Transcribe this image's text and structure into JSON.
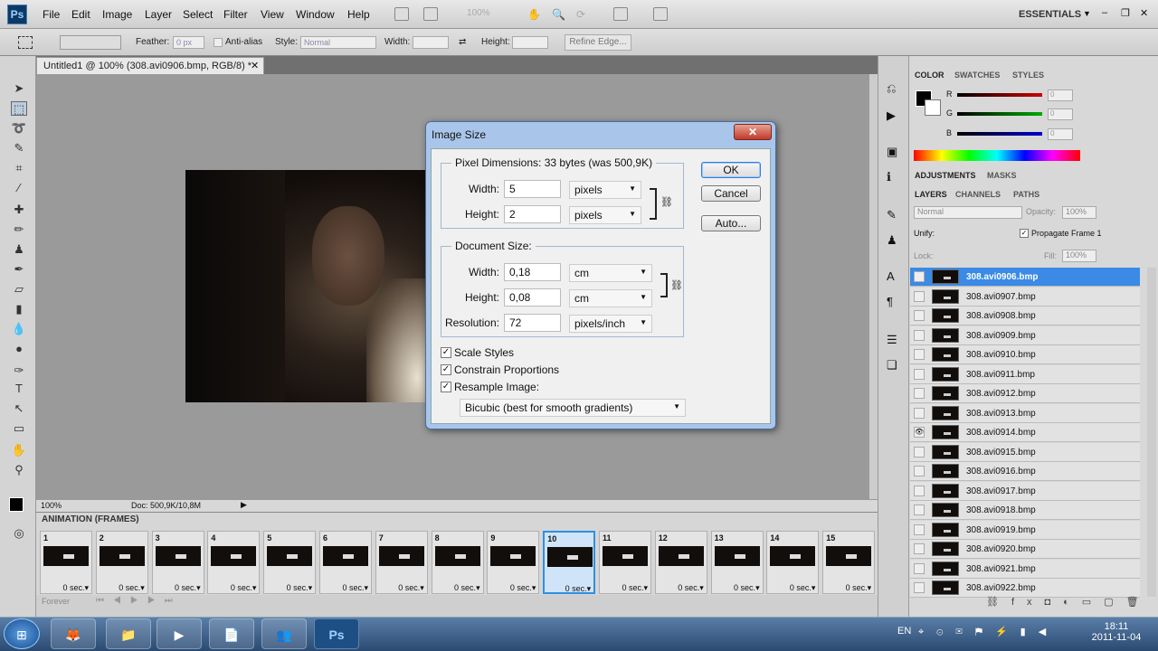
{
  "app": {
    "logo": "Ps",
    "workspace": "ESSENTIALS",
    "zoom_field": "100%"
  },
  "menu": [
    "File",
    "Edit",
    "Image",
    "Layer",
    "Select",
    "Filter",
    "View",
    "Window",
    "Help"
  ],
  "options": {
    "feather_label": "Feather:",
    "feather_value": "0 px",
    "antialias": "Anti-alias",
    "style_label": "Style:",
    "style_value": "Normal",
    "width_label": "Width:",
    "height_label": "Height:",
    "refine_edge": "Refine Edge..."
  },
  "document": {
    "tab_title": "Untitled1 @ 100% (308.avi0906.bmp, RGB/8) *",
    "status_zoom": "100%",
    "status_doc": "Doc: 500,9K/10,8M"
  },
  "animation": {
    "title": "ANIMATION (FRAMES)",
    "loop": "Forever",
    "frames": [
      {
        "n": "1",
        "d": "0 sec."
      },
      {
        "n": "2",
        "d": "0 sec."
      },
      {
        "n": "3",
        "d": "0 sec."
      },
      {
        "n": "4",
        "d": "0 sec."
      },
      {
        "n": "5",
        "d": "0 sec."
      },
      {
        "n": "6",
        "d": "0 sec."
      },
      {
        "n": "7",
        "d": "0 sec."
      },
      {
        "n": "8",
        "d": "0 sec."
      },
      {
        "n": "9",
        "d": "0 sec."
      },
      {
        "n": "10",
        "d": "0 sec."
      },
      {
        "n": "11",
        "d": "0 sec."
      },
      {
        "n": "12",
        "d": "0 sec."
      },
      {
        "n": "13",
        "d": "0 sec."
      },
      {
        "n": "14",
        "d": "0 sec."
      },
      {
        "n": "15",
        "d": "0 sec."
      }
    ],
    "selected_frame": "10"
  },
  "color_panel": {
    "tabs": [
      "COLOR",
      "SWATCHES",
      "STYLES"
    ],
    "r_label": "R",
    "g_label": "G",
    "b_label": "B",
    "r": "0",
    "g": "0",
    "b": "0",
    "colors": {
      "r": "#cc0000",
      "g": "#00aa00",
      "b": "#0000cc"
    }
  },
  "adjust_tabs": [
    "ADJUSTMENTS",
    "MASKS"
  ],
  "layers_panel": {
    "tabs": [
      "LAYERS",
      "CHANNELS",
      "PATHS"
    ],
    "blend": "Normal",
    "opacity_label": "Opacity:",
    "opacity": "100%",
    "unify": "Unify:",
    "propagate": "Propagate Frame 1",
    "lock": "Lock:",
    "fill_label": "Fill:",
    "fill": "100%",
    "layers": [
      "308.avi0906.bmp",
      "308.avi0907.bmp",
      "308.avi0908.bmp",
      "308.avi0909.bmp",
      "308.avi0910.bmp",
      "308.avi0911.bmp",
      "308.avi0912.bmp",
      "308.avi0913.bmp",
      "308.avi0914.bmp",
      "308.avi0915.bmp",
      "308.avi0916.bmp",
      "308.avi0917.bmp",
      "308.avi0918.bmp",
      "308.avi0919.bmp",
      "308.avi0920.bmp",
      "308.avi0921.bmp",
      "308.avi0922.bmp"
    ],
    "visible_layer": "308.avi0914.bmp"
  },
  "dialog": {
    "title": "Image Size",
    "close": "✕",
    "pixel_dims_label": "Pixel Dimensions:  33 bytes (was 500,9K)",
    "px_width_label": "Width:",
    "px_width": "5",
    "px_width_unit": "pixels",
    "px_height_label": "Height:",
    "px_height": "2",
    "px_height_unit": "pixels",
    "doc_size_label": "Document Size:",
    "doc_width_label": "Width:",
    "doc_width": "0,18",
    "doc_width_unit": "cm",
    "doc_height_label": "Height:",
    "doc_height": "0,08",
    "doc_height_unit": "cm",
    "resolution_label": "Resolution:",
    "resolution": "72",
    "resolution_unit": "pixels/inch",
    "scale_styles": "Scale Styles",
    "constrain": "Constrain Proportions",
    "resample": "Resample Image:",
    "resample_method": "Bicubic (best for smooth gradients)",
    "ok": "OK",
    "cancel": "Cancel",
    "auto": "Auto..."
  },
  "taskbar": {
    "lang": "EN",
    "time": "18:11",
    "date": "2011-11-04"
  }
}
